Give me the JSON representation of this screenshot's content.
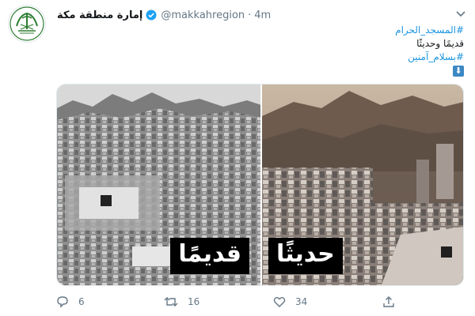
{
  "tweet": {
    "display_name": "إمارة منطقة مكة",
    "handle": "@makkahregion",
    "separator": "·",
    "timestamp": "4m",
    "lines": {
      "hashtag1": "#المسجد_الحرام",
      "text": "قديمًا وحديثًا",
      "hashtag2": "#بسلام_آمنين",
      "emoji": "⬇"
    },
    "media": {
      "left_caption": "قديمًا",
      "right_caption": "حديثًا"
    },
    "actions": {
      "replies": "6",
      "retweets": "16",
      "likes": "34"
    }
  },
  "icons": {
    "avatar": "emblem-logo",
    "verified": "verified-badge-icon",
    "caret": "chevron-down-icon",
    "reply": "reply-icon",
    "retweet": "retweet-icon",
    "like": "heart-icon",
    "share": "share-icon"
  },
  "colors": {
    "link": "#1b95e0",
    "secondary_text": "#657786",
    "verified": "#1da1f2",
    "emblem_green": "#2e7d32"
  }
}
